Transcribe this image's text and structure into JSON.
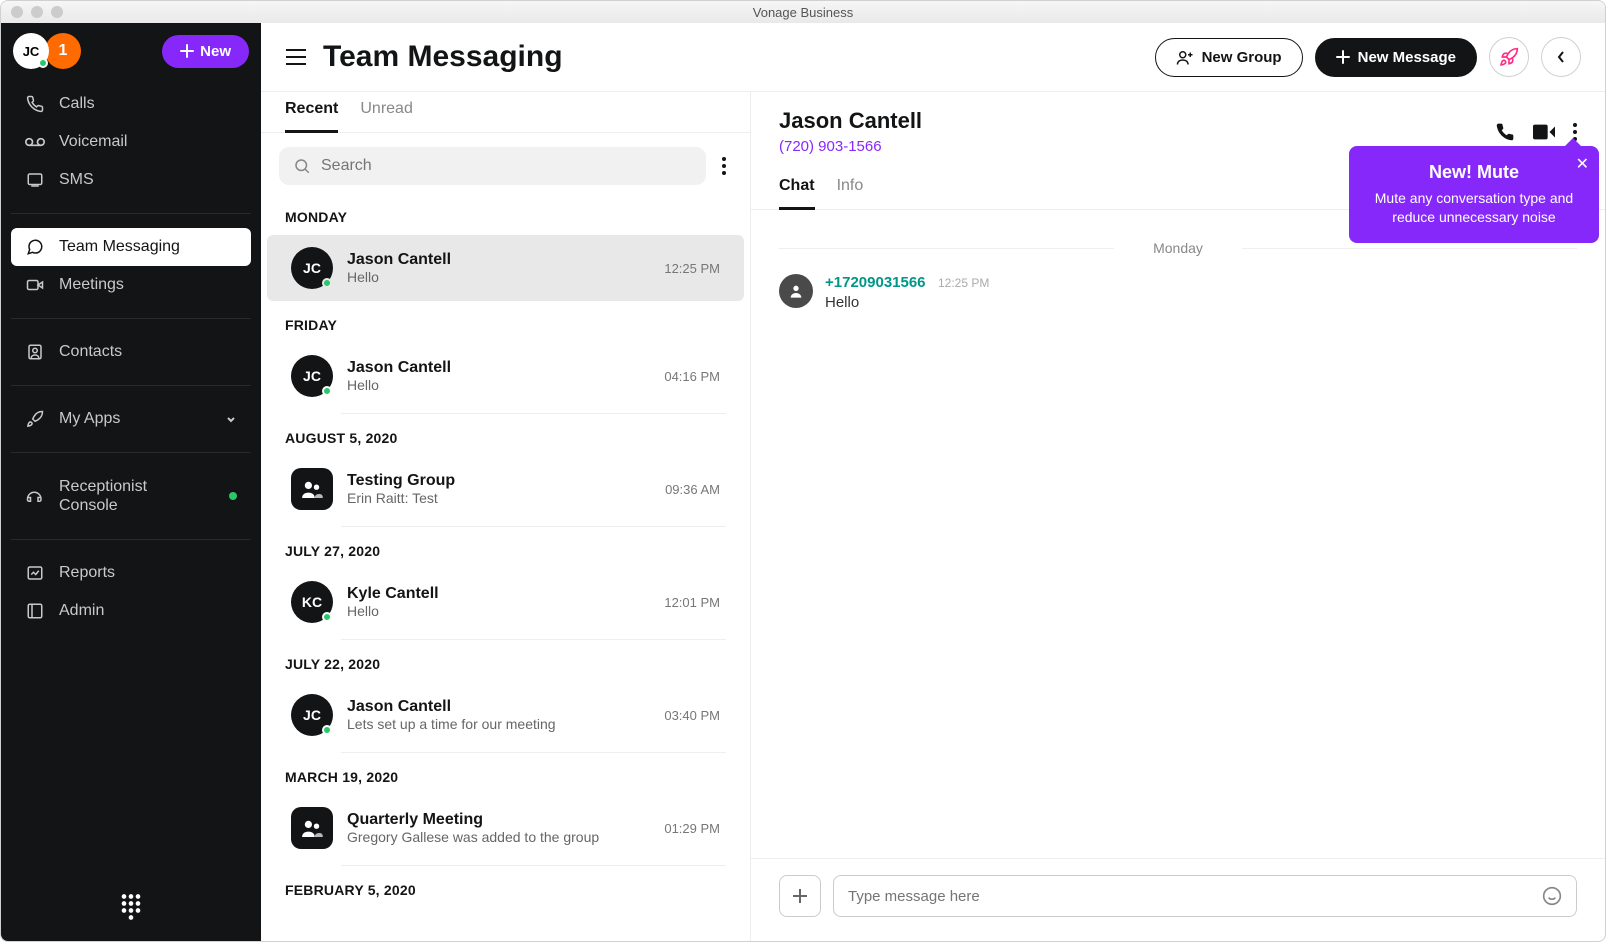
{
  "window": {
    "title": "Vonage Business"
  },
  "sidebar": {
    "user_initials": "JC",
    "badge_count": "1",
    "new_label": "New",
    "items": [
      {
        "label": "Calls"
      },
      {
        "label": "Voicemail"
      },
      {
        "label": "SMS"
      },
      {
        "label": "Team Messaging"
      },
      {
        "label": "Meetings"
      },
      {
        "label": "Contacts"
      },
      {
        "label": "My Apps"
      },
      {
        "label": "Receptionist Console"
      },
      {
        "label": "Reports"
      },
      {
        "label": "Admin"
      }
    ]
  },
  "header": {
    "title": "Team Messaging",
    "new_group_label": "New Group",
    "new_message_label": "New Message"
  },
  "list": {
    "tabs": {
      "recent": "Recent",
      "unread": "Unread"
    },
    "search_placeholder": "Search",
    "groups": [
      {
        "heading": "MONDAY",
        "items": [
          {
            "initials": "JC",
            "title": "Jason Cantell",
            "preview": "Hello",
            "time": "12:25 PM",
            "type": "person",
            "selected": true
          }
        ]
      },
      {
        "heading": "FRIDAY",
        "items": [
          {
            "initials": "JC",
            "title": "Jason Cantell",
            "preview": "Hello",
            "time": "04:16 PM",
            "type": "person"
          }
        ]
      },
      {
        "heading": "AUGUST 5, 2020",
        "items": [
          {
            "initials": "",
            "title": "Testing Group",
            "preview": "Erin Raitt: Test",
            "time": "09:36 AM",
            "type": "group"
          }
        ]
      },
      {
        "heading": "JULY 27, 2020",
        "items": [
          {
            "initials": "KC",
            "title": "Kyle Cantell",
            "preview": "Hello",
            "time": "12:01 PM",
            "type": "person"
          }
        ]
      },
      {
        "heading": "JULY 22, 2020",
        "items": [
          {
            "initials": "JC",
            "title": "Jason Cantell",
            "preview": "Lets set up a time for our meeting",
            "time": "03:40 PM",
            "type": "person"
          }
        ]
      },
      {
        "heading": "MARCH 19, 2020",
        "items": [
          {
            "initials": "",
            "title": "Quarterly Meeting",
            "preview": "Gregory Gallese was added to the group",
            "time": "01:29 PM",
            "type": "group"
          }
        ]
      },
      {
        "heading": "FEBRUARY 5, 2020",
        "items": []
      }
    ]
  },
  "detail": {
    "name": "Jason Cantell",
    "phone": "(720) 903-1566",
    "tabs": {
      "chat": "Chat",
      "info": "Info"
    },
    "day_label": "Monday",
    "message": {
      "sender": "+17209031566",
      "time": "12:25 PM",
      "text": "Hello"
    },
    "composer_placeholder": "Type message here"
  },
  "tooltip": {
    "title": "New! Mute",
    "body": "Mute any conversation type and reduce unnecessary noise"
  }
}
